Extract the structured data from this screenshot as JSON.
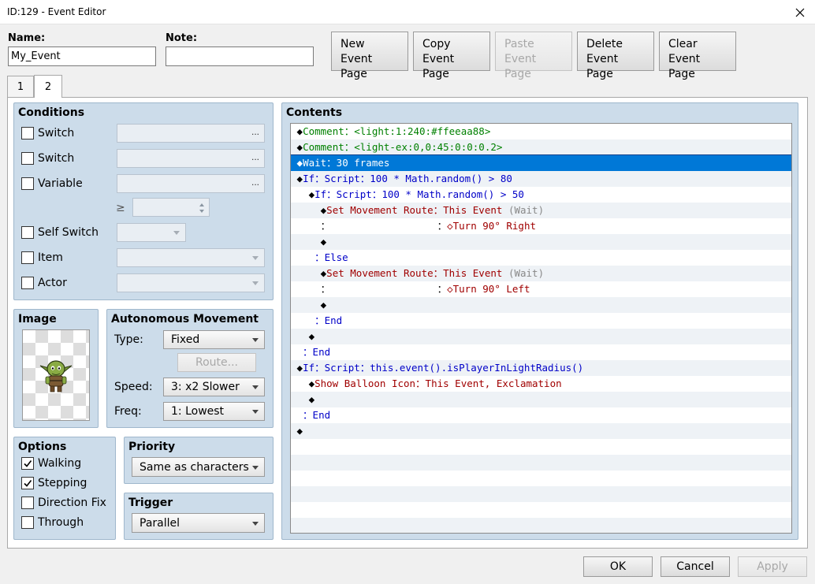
{
  "window": {
    "title": "ID:129 - Event Editor"
  },
  "fields": {
    "name_label": "Name:",
    "name_value": "My_Event",
    "note_label": "Note:",
    "note_value": ""
  },
  "page_buttons": [
    {
      "line1": "New",
      "line2": "Event Page",
      "enabled": true
    },
    {
      "line1": "Copy",
      "line2": "Event Page",
      "enabled": true
    },
    {
      "line1": "Paste",
      "line2": "Event Page",
      "enabled": false
    },
    {
      "line1": "Delete",
      "line2": "Event Page",
      "enabled": true
    },
    {
      "line1": "Clear",
      "line2": "Event Page",
      "enabled": true
    }
  ],
  "tabs": [
    "1",
    "2"
  ],
  "conditions": {
    "title": "Conditions",
    "switch1": "Switch",
    "switch2": "Switch",
    "variable": "Variable",
    "ge_symbol": "≥",
    "self_switch": "Self Switch",
    "item": "Item",
    "actor": "Actor",
    "ellipsis": "..."
  },
  "image": {
    "title": "Image"
  },
  "movement": {
    "title": "Autonomous Movement",
    "type_label": "Type:",
    "type_value": "Fixed",
    "route_label": "Route...",
    "speed_label": "Speed:",
    "speed_value": "3: x2 Slower",
    "freq_label": "Freq:",
    "freq_value": "1: Lowest"
  },
  "options": {
    "title": "Options",
    "walking": "Walking",
    "stepping": "Stepping",
    "direction_fix": "Direction Fix",
    "through": "Through"
  },
  "priority": {
    "title": "Priority",
    "value": "Same as characters"
  },
  "trigger": {
    "title": "Trigger",
    "value": "Parallel"
  },
  "contents": {
    "title": "Contents",
    "rows": [
      [
        [
          "c-black",
          "◆"
        ],
        [
          "c-green",
          "Comment："
        ],
        [
          "c-green",
          "<light:1:240:#ffeeaa88>"
        ]
      ],
      [
        [
          "c-black",
          "◆"
        ],
        [
          "c-green",
          "Comment："
        ],
        [
          "c-green",
          "<light-ex:0,0:45:0:0:0.2>"
        ]
      ],
      [
        [
          "c-black",
          "◆"
        ],
        [
          "c-black",
          "Wait："
        ],
        [
          "c-black",
          "30 frames"
        ]
      ],
      [
        [
          "c-black",
          "◆"
        ],
        [
          "c-blue",
          "If：Script：100 * Math.random() > 80"
        ]
      ],
      [
        [
          "c-black",
          "  ◆"
        ],
        [
          "c-blue",
          "If：Script：100 * Math.random() > 50"
        ]
      ],
      [
        [
          "c-black",
          "    ◆"
        ],
        [
          "c-red",
          "Set Movement Route："
        ],
        [
          "c-red",
          "This Event "
        ],
        [
          "c-gray",
          "(Wait)"
        ]
      ],
      [
        [
          "c-black",
          "    ："
        ],
        [
          "c-black",
          "                  ："
        ],
        [
          "c-red",
          "◇Turn 90° Right"
        ]
      ],
      [
        [
          "c-black",
          "    ◆"
        ]
      ],
      [
        [
          "c-blue",
          "   ：Else"
        ]
      ],
      [
        [
          "c-black",
          "    ◆"
        ],
        [
          "c-red",
          "Set Movement Route："
        ],
        [
          "c-red",
          "This Event "
        ],
        [
          "c-gray",
          "(Wait)"
        ]
      ],
      [
        [
          "c-black",
          "    ："
        ],
        [
          "c-black",
          "                  ："
        ],
        [
          "c-red",
          "◇Turn 90° Left"
        ]
      ],
      [
        [
          "c-black",
          "    ◆"
        ]
      ],
      [
        [
          "c-blue",
          "   ：End"
        ]
      ],
      [
        [
          "c-black",
          "  ◆"
        ]
      ],
      [
        [
          "c-blue",
          " ：End"
        ]
      ],
      [
        [
          "c-black",
          "◆"
        ],
        [
          "c-blue",
          "If：Script：this.event().isPlayerInLightRadius()"
        ]
      ],
      [
        [
          "c-black",
          "  ◆"
        ],
        [
          "c-red",
          "Show Balloon Icon：This Event, Exclamation"
        ]
      ],
      [
        [
          "c-black",
          "  ◆"
        ]
      ],
      [
        [
          "c-blue",
          " ：End"
        ]
      ],
      [
        [
          "c-black",
          "◆"
        ]
      ],
      [],
      [],
      [],
      [],
      [],
      []
    ],
    "selected_index": 2
  },
  "footer": {
    "ok": "OK",
    "cancel": "Cancel",
    "apply": "Apply"
  }
}
